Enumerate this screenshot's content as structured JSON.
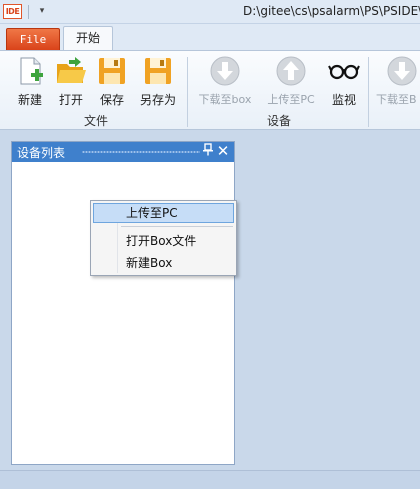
{
  "window": {
    "app_icon_text": "IDE",
    "title": "D:\\gitee\\cs\\psalarm\\PS\\PSIDE\\"
  },
  "tabs": {
    "file_label": "File",
    "home_label": "开始"
  },
  "ribbon": {
    "file_group": {
      "label": "文件",
      "buttons": [
        {
          "label": "新建",
          "icon": "new-file-icon"
        },
        {
          "label": "打开",
          "icon": "open-folder-icon"
        },
        {
          "label": "保存",
          "icon": "save-icon"
        },
        {
          "label": "另存为",
          "icon": "save-as-icon"
        }
      ]
    },
    "device_group": {
      "label": "设备",
      "buttons": [
        {
          "label": "下载至box",
          "icon": "download-icon",
          "enabled": false
        },
        {
          "label": "上传至PC",
          "icon": "upload-icon",
          "enabled": false
        },
        {
          "label": "监视",
          "icon": "glasses-icon",
          "enabled": true
        }
      ]
    },
    "next_group": {
      "buttons": [
        {
          "label": "下载至B",
          "icon": "download-icon",
          "enabled": false
        }
      ]
    }
  },
  "panel": {
    "title": "设备列表",
    "pin_glyph": "📌",
    "close_glyph": "✕"
  },
  "context_menu": {
    "items": [
      {
        "label": "上传至PC",
        "highlighted": true
      },
      {
        "label": "打开Box文件",
        "highlighted": false
      },
      {
        "label": "新建Box",
        "highlighted": false
      }
    ]
  },
  "colors": {
    "file_tab": "#e0552b",
    "panel_header": "#3f80cc",
    "menu_highlight": "#c6ddf7"
  }
}
